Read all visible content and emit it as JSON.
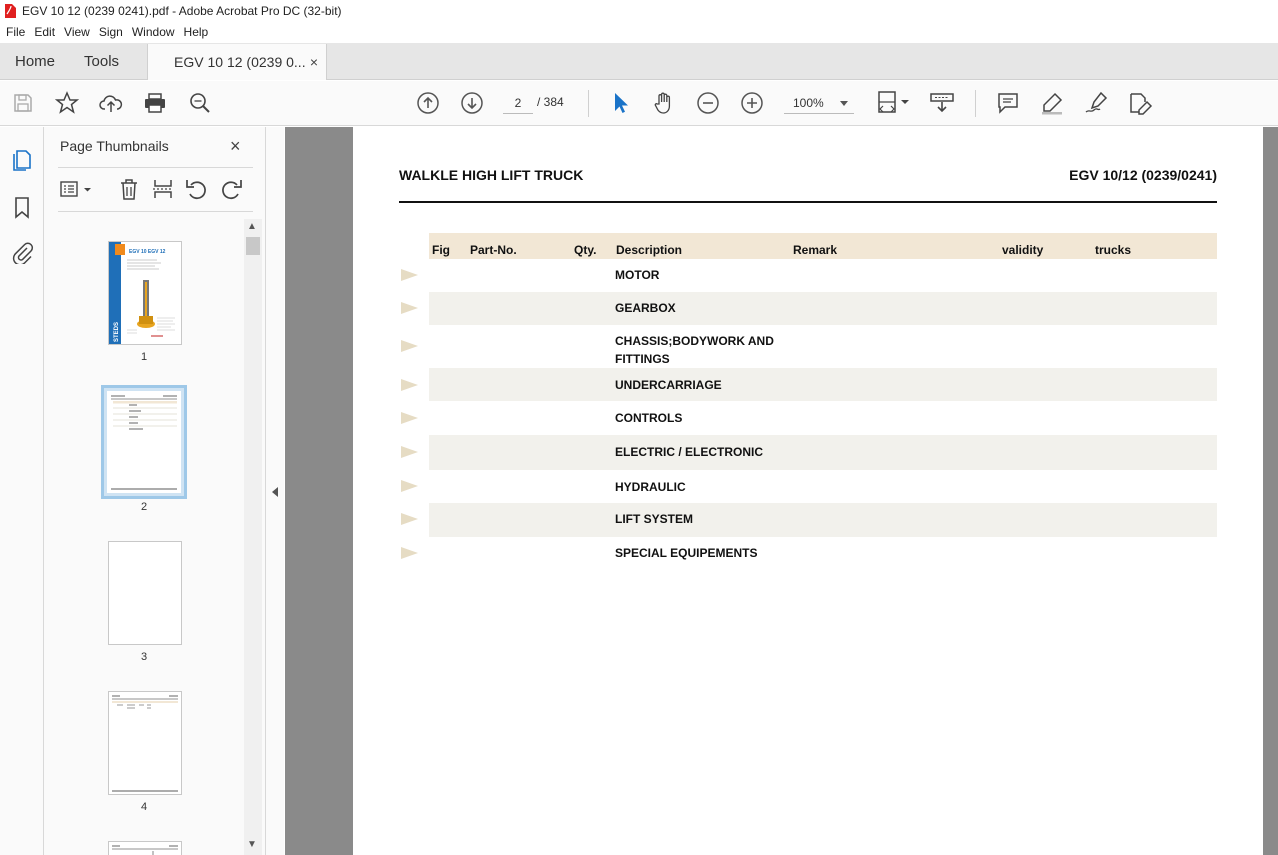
{
  "window": {
    "title": "EGV 10 12 (0239 0241).pdf - Adobe Acrobat Pro DC (32-bit)"
  },
  "menu": [
    "File",
    "Edit",
    "View",
    "Sign",
    "Window",
    "Help"
  ],
  "tabs": {
    "home": "Home",
    "tools": "Tools",
    "document": "EGV 10 12 (0239 0...",
    "close_glyph": "×"
  },
  "toolbar": {
    "page_current": "2",
    "page_total": "/ 384",
    "zoom": "100%"
  },
  "sidebar": {
    "title": "Page Thumbnails",
    "close_glyph": "×",
    "thumbnails": [
      {
        "label": "1"
      },
      {
        "label": "2",
        "selected": true
      },
      {
        "label": "3"
      },
      {
        "label": "4"
      }
    ]
  },
  "document": {
    "header_left": "WALKLE HIGH LIFT TRUCK",
    "header_right": "EGV 10/12 (0239/0241)",
    "columns": [
      "Fig",
      "Part-No.",
      "Qty.",
      "Description",
      "Remark",
      "validity",
      "trucks"
    ],
    "rows": [
      {
        "description": "MOTOR"
      },
      {
        "description": "GEARBOX"
      },
      {
        "description": "CHASSIS;BODYWORK AND\nFITTINGS"
      },
      {
        "description": "UNDERCARRIAGE"
      },
      {
        "description": "CONTROLS"
      },
      {
        "description": "ELECTRIC / ELECTRONIC"
      },
      {
        "description": "HYDRAULIC"
      },
      {
        "description": "LIFT SYSTEM"
      },
      {
        "description": "SPECIAL EQUIPEMENTS"
      }
    ]
  },
  "thumb1_text": {
    "title": "EGV 10   EGV 12",
    "brand": "STEDS"
  },
  "colors": {
    "accent": "#1a73c8",
    "header_band": "#f2e7d5",
    "row_shade": "#f2f1ec"
  }
}
